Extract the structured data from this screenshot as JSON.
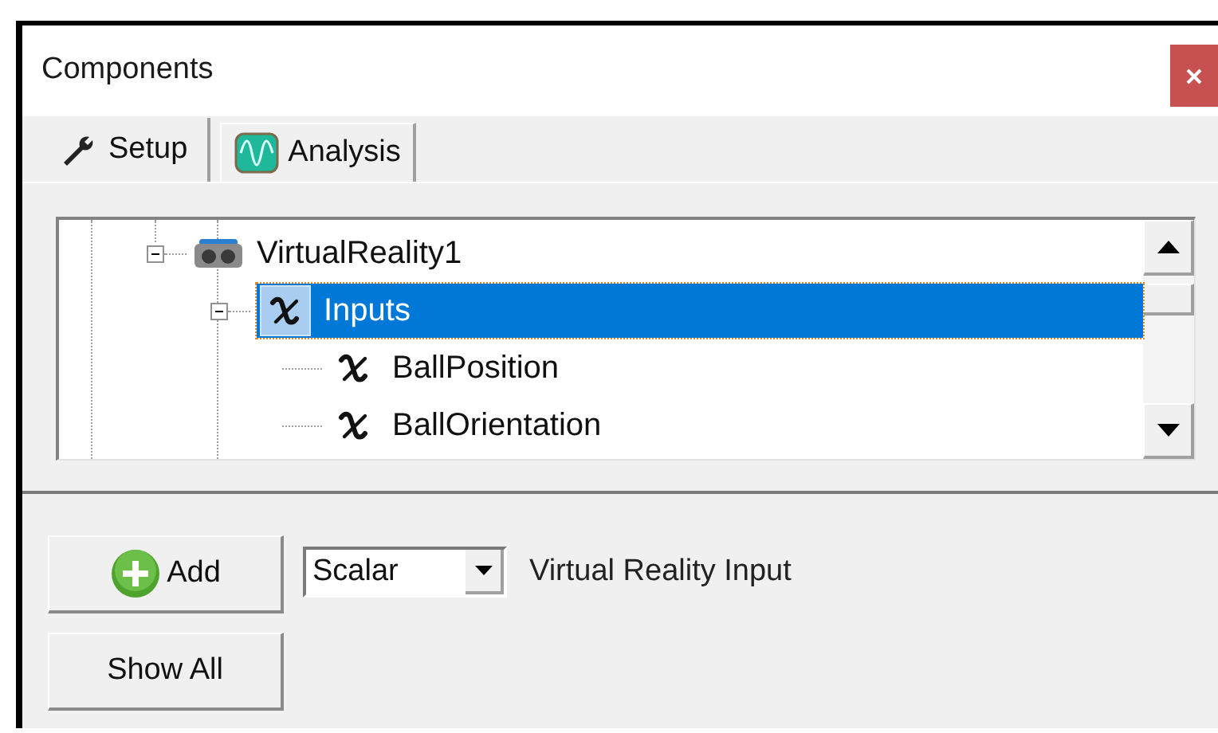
{
  "window": {
    "title": "Components"
  },
  "tabs": [
    {
      "label": "Setup",
      "kind": "setup",
      "selected": true
    },
    {
      "label": "Analysis",
      "kind": "analysis",
      "selected": false
    }
  ],
  "tree": [
    {
      "label": "VirtualReality1",
      "kind": "device",
      "expanded": true,
      "selected": false,
      "children": [
        {
          "label": "Inputs",
          "kind": "variable",
          "expanded": true,
          "selected": true,
          "children": [
            {
              "label": "BallPosition",
              "kind": "variable",
              "selected": false
            },
            {
              "label": "BallOrientation",
              "kind": "variable",
              "selected": false
            }
          ]
        }
      ]
    }
  ],
  "buttons": [
    {
      "label": "Add",
      "kind": "add"
    },
    {
      "label": "Show All",
      "kind": "plain"
    }
  ],
  "type_dropdown": {
    "value": "Scalar"
  },
  "type_label": "Virtual Reality Input"
}
